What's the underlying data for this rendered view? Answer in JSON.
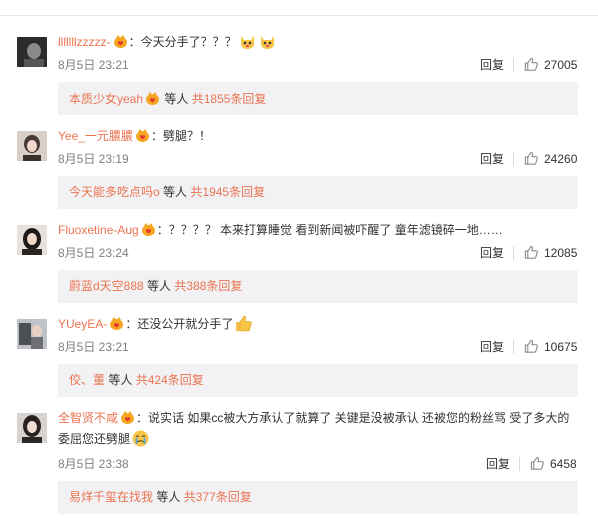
{
  "colors": {
    "accent": "#eb7350",
    "box": "#f2f2f5",
    "meta": "#808080"
  },
  "comments": [
    {
      "username": "lllllllzzzzz-",
      "text": "：今天分手了？？？",
      "emojis": [
        "cat-face-emoji",
        "cat-face-emoji"
      ],
      "date": "8月5日 23:21",
      "reply_label": "回复",
      "likes": "27005",
      "sub_user": "本质少女yeah",
      "sub_middle": "等人",
      "sub_total": "共1855条回复"
    },
    {
      "username": "Yee_一元膿膿",
      "text": "：劈腿？！",
      "date": "8月5日 23:19",
      "reply_label": "回复",
      "likes": "24260",
      "sub_user": "今天能多吃点吗o",
      "sub_middle": "等人",
      "sub_total": "共1945条回复"
    },
    {
      "username": "Fluoxetine-Aug",
      "text": "：？？？？ 本来打算睡觉 看到新闻被吓醒了 童年滤镜碎一地……",
      "date": "8月5日 23:24",
      "reply_label": "回复",
      "likes": "12085",
      "sub_user": "蔚蓝d天空888",
      "sub_middle": "等人",
      "sub_total": "共388条回复"
    },
    {
      "username": "YUeyEA-",
      "text": "：还没公开就分手了",
      "emojis": [
        "thumbs-up-emoji"
      ],
      "date": "8月5日 23:21",
      "reply_label": "回复",
      "likes": "10675",
      "sub_user": "佼、董",
      "sub_middle": "等人",
      "sub_total": "共424条回复"
    },
    {
      "username": "全智贤不咸",
      "text": "：说实话 如果cc被大方承认了就算了 关键是没被承认 还被您的粉丝骂 受了多大的委屈您还劈腿",
      "emojis": [
        "crying-face-emoji"
      ],
      "date": "8月5日 23:38",
      "reply_label": "回复",
      "likes": "6458",
      "sub_user": "易烊千玺在找我",
      "sub_middle": "等人",
      "sub_total": "共377条回复"
    }
  ]
}
